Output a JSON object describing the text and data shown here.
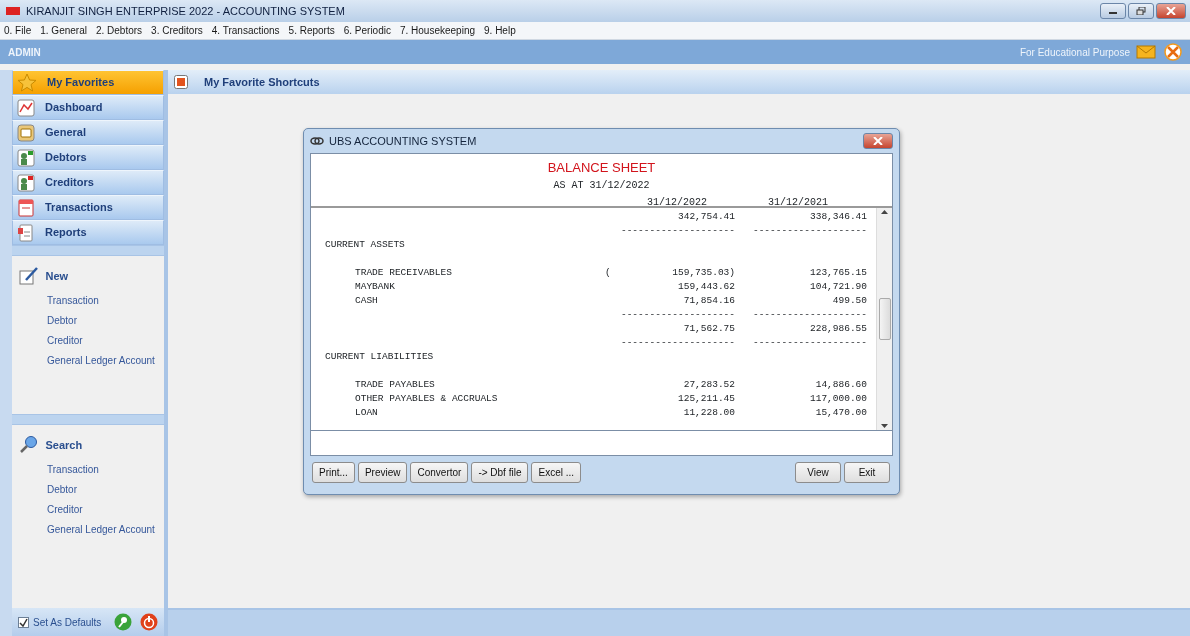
{
  "window": {
    "title": "KIRANJIT SINGH ENTERPRISE 2022 - ACCOUNTING SYSTEM"
  },
  "menu": [
    "0. File",
    "1. General",
    "2. Debtors",
    "3. Creditors",
    "4. Transactions",
    "5. Reports",
    "6. Periodic",
    "7. Housekeeping",
    "9. Help"
  ],
  "user_bar": {
    "user": "ADMIN",
    "note": "For Educational Purpose"
  },
  "sidebar": {
    "items": [
      {
        "label": "My Favorites",
        "selected": true
      },
      {
        "label": "Dashboard",
        "selected": false
      },
      {
        "label": "General",
        "selected": false
      },
      {
        "label": "Debtors",
        "selected": false
      },
      {
        "label": "Creditors",
        "selected": false
      },
      {
        "label": "Transactions",
        "selected": false
      },
      {
        "label": "Reports",
        "selected": false
      }
    ],
    "panels": [
      {
        "title": "New",
        "links": [
          "Transaction",
          "Debtor",
          "Creditor",
          "General Ledger Account"
        ]
      },
      {
        "title": "Search",
        "links": [
          "Transaction",
          "Debtor",
          "Creditor",
          "General Ledger Account"
        ]
      }
    ],
    "footer": {
      "label": "Set As Defaults",
      "checked": true
    }
  },
  "content": {
    "title": "My Favorite Shortcuts"
  },
  "dialog": {
    "title": "UBS ACCOUNTING SYSTEM",
    "report": {
      "title": "BALANCE SHEET",
      "subtitle": "AS AT 31/12/2022",
      "columns": [
        "31/12/2022",
        "31/12/2021"
      ],
      "rows": [
        {
          "kind": "amount",
          "amounts": [
            "342,754.41",
            "338,346.41"
          ]
        },
        {
          "kind": "rule",
          "amounts": [
            "--------------------",
            "--------------------"
          ]
        },
        {
          "kind": "heading",
          "label": "CURRENT ASSETS"
        },
        {
          "kind": "item",
          "label": "TRADE RECEIVABLES",
          "sign": "(",
          "amounts": [
            "159,735.03)",
            "123,765.15"
          ]
        },
        {
          "kind": "item",
          "label": "MAYBANK",
          "amounts": [
            "159,443.62",
            "104,721.90"
          ]
        },
        {
          "kind": "item",
          "label": "CASH",
          "amounts": [
            "71,854.16",
            "499.50"
          ]
        },
        {
          "kind": "rule",
          "amounts": [
            "--------------------",
            "--------------------"
          ]
        },
        {
          "kind": "amount",
          "amounts": [
            "71,562.75",
            "228,986.55"
          ]
        },
        {
          "kind": "rule",
          "amounts": [
            "--------------------",
            "--------------------"
          ]
        },
        {
          "kind": "heading",
          "label": "CURRENT LIABILITIES"
        },
        {
          "kind": "item",
          "label": "TRADE PAYABLES",
          "amounts": [
            "27,283.52",
            "14,886.60"
          ]
        },
        {
          "kind": "item",
          "label": "OTHER PAYABLES & ACCRUALS",
          "amounts": [
            "125,211.45",
            "117,000.00"
          ]
        },
        {
          "kind": "item",
          "label": "LOAN",
          "amounts": [
            "11,228.00",
            "15,470.00"
          ]
        }
      ]
    },
    "buttons_left": [
      "Print...",
      "Preview",
      "Convertor",
      "-> Dbf file",
      "Excel ..."
    ],
    "buttons_right": [
      "View",
      "Exit"
    ]
  }
}
